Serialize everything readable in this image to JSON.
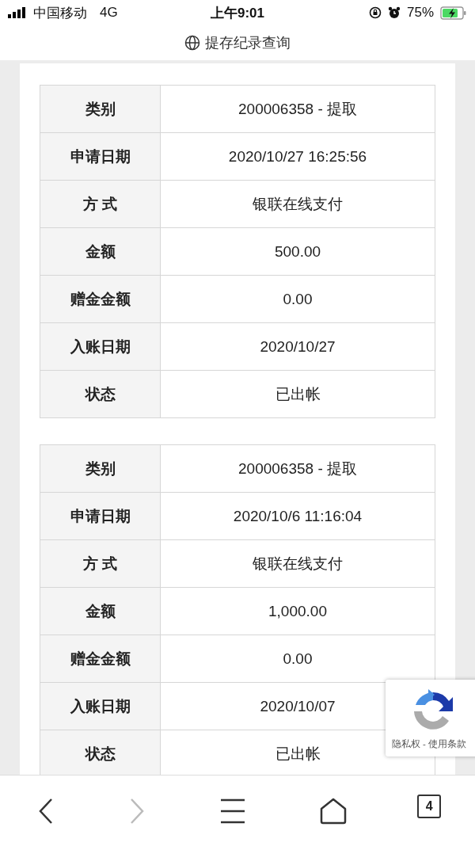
{
  "status_bar": {
    "carrier": "中国移动",
    "network": "4G",
    "time": "上午9:01",
    "battery": "75%"
  },
  "title": "提存纪录查询",
  "records": [
    {
      "rows": [
        {
          "label": "类别",
          "value": "200006358 - 提取"
        },
        {
          "label": "申请日期",
          "value": "2020/10/27 16:25:56"
        },
        {
          "label": "方 式",
          "value": "银联在线支付"
        },
        {
          "label": "金额",
          "value": "500.00"
        },
        {
          "label": "赠金金额",
          "value": "0.00"
        },
        {
          "label": "入账日期",
          "value": "2020/10/27"
        },
        {
          "label": "状态",
          "value": "已出帐"
        }
      ]
    },
    {
      "rows": [
        {
          "label": "类别",
          "value": "200006358 - 提取"
        },
        {
          "label": "申请日期",
          "value": "2020/10/6 11:16:04"
        },
        {
          "label": "方 式",
          "value": "银联在线支付"
        },
        {
          "label": "金额",
          "value": "1,000.00"
        },
        {
          "label": "赠金金额",
          "value": "0.00"
        },
        {
          "label": "入账日期",
          "value": "2020/10/07"
        },
        {
          "label": "状态",
          "value": "已出帐"
        }
      ]
    }
  ],
  "recaptcha": {
    "links": "隐私权 - 使用条款"
  },
  "toolbar": {
    "back_disabled": false,
    "forward_disabled": true,
    "tab_count": "4"
  }
}
